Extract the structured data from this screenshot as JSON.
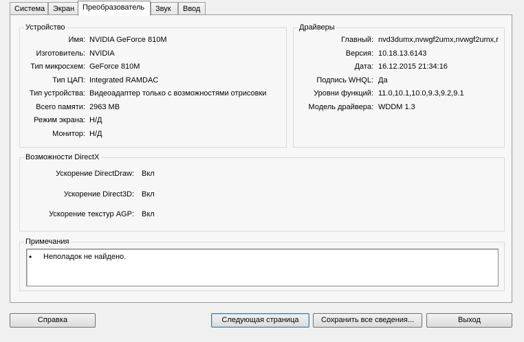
{
  "tabs": [
    "Система",
    "Экран",
    "Преобразователь",
    "Звук",
    "Ввод"
  ],
  "device": {
    "title": "Устройство",
    "rows": [
      {
        "label": "Имя:",
        "value": "NVIDIA GeForce 810M"
      },
      {
        "label": "Изготовитель:",
        "value": "NVIDIA"
      },
      {
        "label": "Тип микросхем:",
        "value": "GeForce 810M"
      },
      {
        "label": "Тип ЦАП:",
        "value": "Integrated RAMDAC"
      },
      {
        "label": "Тип устройства:",
        "value": "Видеоадаптер только с возможностями отрисовки"
      },
      {
        "label": "Всего памяти:",
        "value": "2963 MB"
      },
      {
        "label": "Режим экрана:",
        "value": "Н/Д"
      },
      {
        "label": "Монитор:",
        "value": "Н/Д"
      }
    ]
  },
  "drivers": {
    "title": "Драйверы",
    "rows": [
      {
        "label": "Главный:",
        "value": "nvd3dumx,nvwgf2umx,nvwgf2umx,r"
      },
      {
        "label": "Версия:",
        "value": "10.18.13.6143"
      },
      {
        "label": "Дата:",
        "value": "16.12.2015 21:34:16"
      },
      {
        "label": "Подпись WHQL:",
        "value": "Да"
      },
      {
        "label": "Уровни функций:",
        "value": "11.0,10.1,10.0,9.3,9.2,9.1"
      },
      {
        "label": "Модель драйвера:",
        "value": "WDDM 1.3"
      }
    ]
  },
  "directx": {
    "title": "Возможности DirectX",
    "rows": [
      {
        "label": "Ускорение DirectDraw:",
        "value": "Вкл"
      },
      {
        "label": "Ускорение Direct3D:",
        "value": "Вкл"
      },
      {
        "label": "Ускорение текстур AGP:",
        "value": "Вкл"
      }
    ]
  },
  "notes": {
    "title": "Примечания",
    "bullet": "•",
    "text": "Неполадок не найдено."
  },
  "buttons": {
    "help": "Справка",
    "next_page": "Следующая страница",
    "save_all": "Сохранить все сведения...",
    "exit": "Выход"
  }
}
